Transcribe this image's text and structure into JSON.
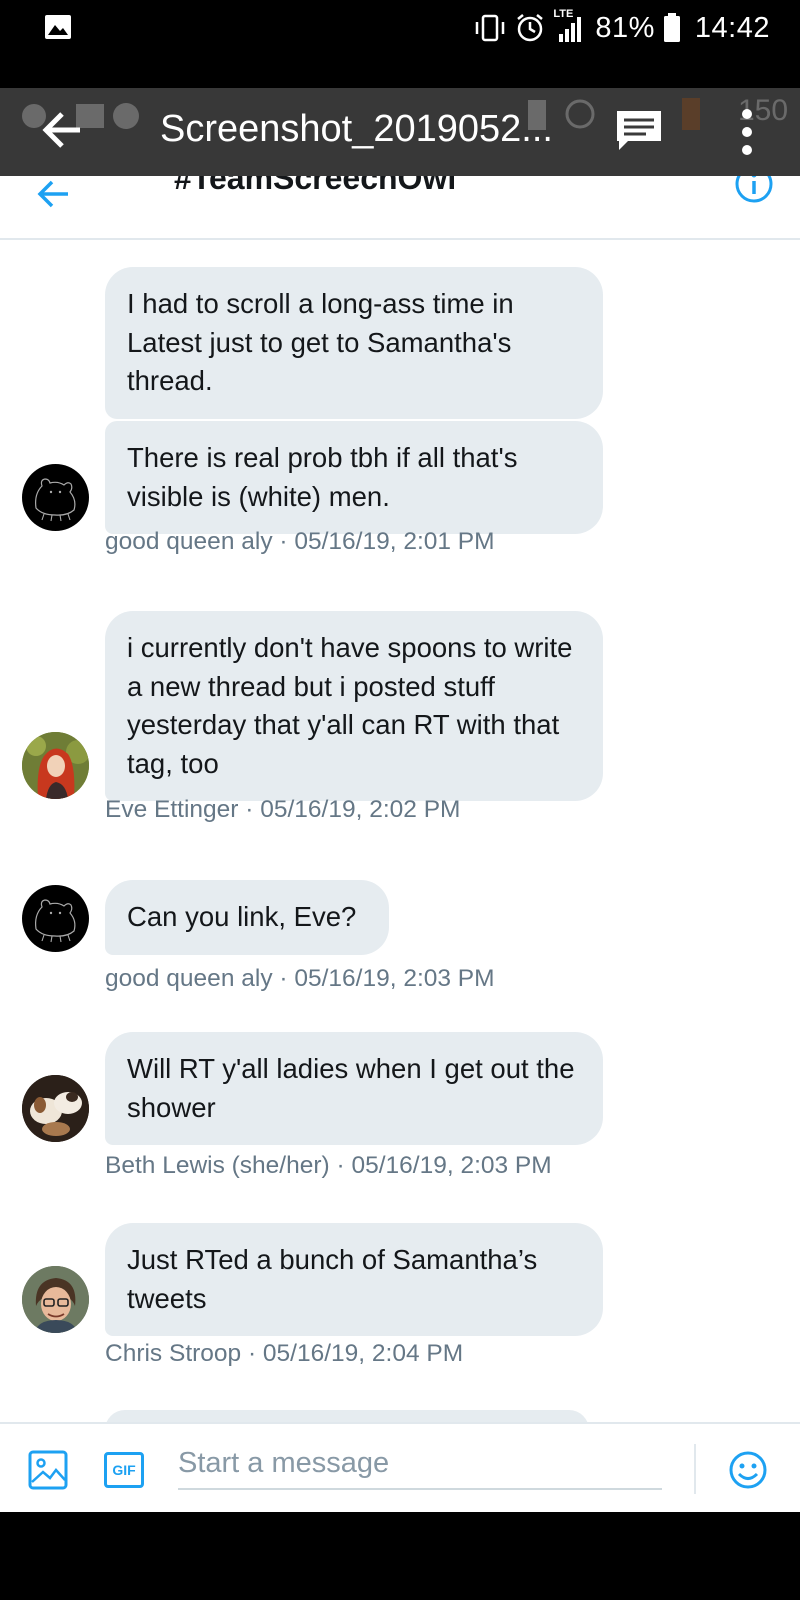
{
  "status_bar": {
    "network_label": "LTE",
    "battery": "81%",
    "time": "14:42"
  },
  "viewer": {
    "title": "Screenshot_2019052...",
    "ghost_time": "150"
  },
  "header": {
    "title": "#TeamScreechOwl"
  },
  "messages": [
    {
      "texts": [
        "I had to scroll a long-ass time in Latest just to get to Samantha's thread.",
        "There is real prob tbh if all that's visible is (white) men."
      ],
      "meta": "good queen aly · 05/16/19, 2:01 PM",
      "avatar": "bear-avatar"
    },
    {
      "texts": [
        "i currently don't have spoons to write a new thread but i posted stuff yesterday that y'all can RT with that tag, too"
      ],
      "meta": "Eve Ettinger · 05/16/19, 2:02 PM",
      "avatar": "redhead-avatar"
    },
    {
      "texts": [
        "Can you link, Eve?"
      ],
      "meta": "good queen aly · 05/16/19, 2:03 PM",
      "avatar": "bear-avatar"
    },
    {
      "texts": [
        "Will RT y'all ladies when I get out the shower"
      ],
      "meta": "Beth Lewis (she/her) · 05/16/19, 2:03 PM",
      "avatar": "dogs-avatar"
    },
    {
      "texts": [
        "Just RTed a bunch of Samantha’s tweets"
      ],
      "meta": "Chris Stroop · 05/16/19, 2:04 PM",
      "avatar": "cartoon-avatar"
    }
  ],
  "composer": {
    "placeholder": "Start a message",
    "gif_label": "GIF"
  },
  "colors": {
    "accent": "#1da1f2",
    "bubble": "#e6ecf0",
    "meta_text": "#657786",
    "overlay": "#3a3a3a"
  }
}
